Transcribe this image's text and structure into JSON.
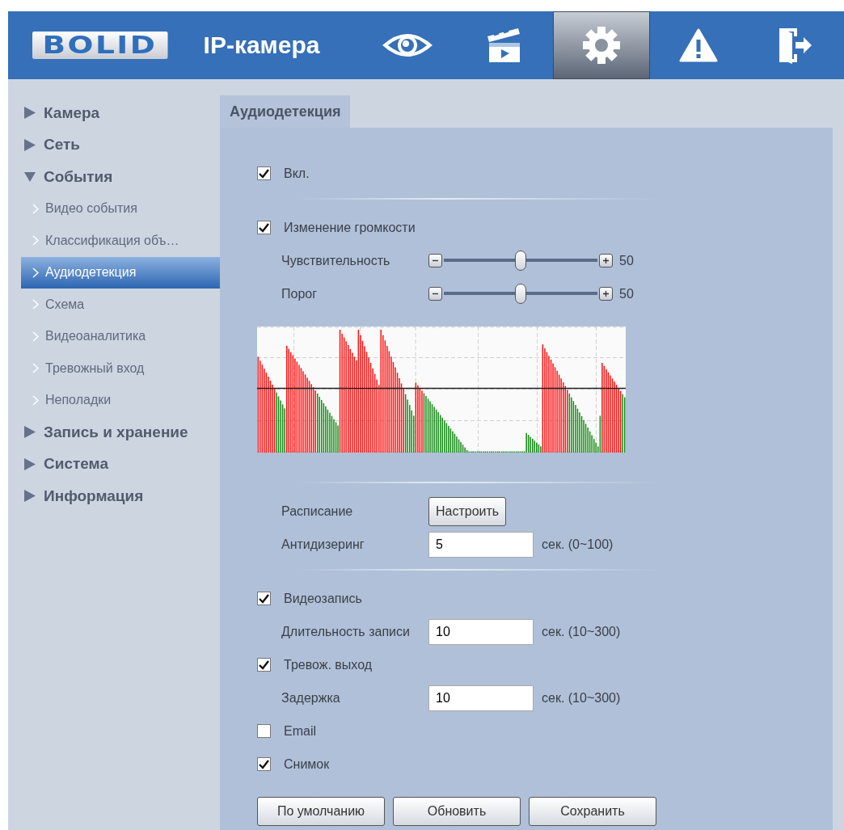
{
  "header": {
    "logo": "BOLID",
    "title": "IP-камера",
    "nav": [
      {
        "kind": "eye",
        "selected": false
      },
      {
        "kind": "clapper",
        "selected": false
      },
      {
        "kind": "gear",
        "selected": true
      },
      {
        "kind": "warning",
        "selected": false
      },
      {
        "kind": "door",
        "selected": false
      }
    ]
  },
  "sidebar": {
    "items": [
      {
        "label": "Камера",
        "expanded": false
      },
      {
        "label": "Сеть",
        "expanded": false
      },
      {
        "label": "События",
        "expanded": true,
        "children": [
          {
            "label": "Видео события",
            "selected": false
          },
          {
            "label": "Классификация объ…",
            "selected": false
          },
          {
            "label": "Аудиодетекция",
            "selected": true
          },
          {
            "label": "Схема",
            "selected": false
          },
          {
            "label": "Видеоаналитика",
            "selected": false
          },
          {
            "label": "Тревожный вход",
            "selected": false
          },
          {
            "label": "Неполадки",
            "selected": false
          }
        ]
      },
      {
        "label": "Запись и хранение",
        "expanded": false
      },
      {
        "label": "Система",
        "expanded": false
      },
      {
        "label": "Информация",
        "expanded": false
      }
    ]
  },
  "tab": {
    "label": "Аудиодетекция",
    "selected": true
  },
  "rows": [
    {
      "kind": "check",
      "label": "Вкл.",
      "checked": true
    },
    {
      "kind": "divider"
    },
    {
      "kind": "check",
      "label": "Изменение громкости",
      "checked": true
    },
    {
      "kind": "slider",
      "label": "Чувствительность",
      "level": 0.5,
      "value": "50"
    },
    {
      "kind": "slider",
      "label": "Порог",
      "level": 0.5,
      "value": "50"
    },
    {
      "kind": "chart"
    },
    {
      "kind": "divider"
    },
    {
      "kind": "button",
      "label": "Расписание",
      "button": "Настроить"
    },
    {
      "kind": "field",
      "label": "Антидизеринг",
      "value": "5",
      "unit": "сек. (0~100)"
    },
    {
      "kind": "divider"
    },
    {
      "kind": "check",
      "label": "Видеозапись",
      "checked": true
    },
    {
      "kind": "field",
      "label": "Длительность записи",
      "value": "10",
      "unit": "сек. (10~300)"
    },
    {
      "kind": "check",
      "label": "Тревож. выход",
      "checked": true
    },
    {
      "kind": "field",
      "label": "Задержка",
      "value": "10",
      "unit": "сек. (10~300)"
    },
    {
      "kind": "check",
      "label": "Email",
      "checked": false
    },
    {
      "kind": "check",
      "label": "Снимок",
      "checked": true
    }
  ],
  "buttons": [
    "По умолчанию",
    "Обновить",
    "Сохранить"
  ]
}
